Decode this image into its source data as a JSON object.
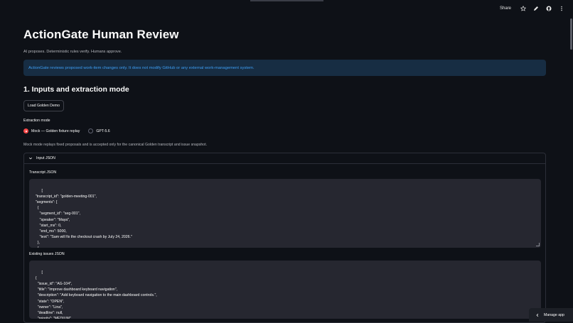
{
  "toolbar": {
    "share_label": "Share",
    "icons": [
      "star-icon",
      "pencil-icon",
      "github-icon",
      "more-vertical-icon"
    ]
  },
  "page": {
    "title": "ActionGate Human Review",
    "caption": "AI proposes. Deterministic rules verify. Humans approve.",
    "info": "ActionGate reviews proposed work-item changes only. It does not modify GitHub or any external work-management system."
  },
  "section1": {
    "heading": "1. Inputs and extraction mode",
    "load_button": "Load Golden Demo",
    "mode_label": "Extraction mode",
    "options": [
      {
        "label": "Mock — Golden fixture replay",
        "selected": true
      },
      {
        "label": "GPT-5.6",
        "selected": false
      }
    ],
    "mock_note": "Mock mode replays fixed proposals and is accepted only for the canonical Golden transcript and issue snapshot."
  },
  "expander": {
    "label": "Input JSON",
    "transcript_label": "Transcript JSON",
    "transcript_text": "[\n  \"transcript_id\": \"golden-meeting-001\",\n  \"segments\": [\n    {\n      \"segment_id\": \"seg-001\",\n      \"speaker\": \"Maya\",\n      \"start_ms\": 0,\n      \"end_ms\": 5000,\n      \"text\": \"Sam will fix the checkout crash by July 24, 2026.\"\n    },\n    {",
    "issues_label": "Existing issues JSON",
    "issues_text": "[\n  {\n    \"issue_id\": \"AG-104\",\n    \"title\": \"Improve dashboard keyboard navigation\",\n    \"description\": \"Add keyboard navigation to the main dashboard controls.\",\n    \"state\": \"OPEN\",\n    \"owner\": \"Lina\",\n    \"deadline\": null,\n    \"priority\": \"MEDIUM\""
  },
  "footer": {
    "manage_label": "Manage app"
  },
  "colors": {
    "background": "#0e1117",
    "info_bg": "#172d43",
    "info_text": "#3d9df3",
    "radio_accent": "#ff4b4b",
    "code_bg": "#262730"
  }
}
